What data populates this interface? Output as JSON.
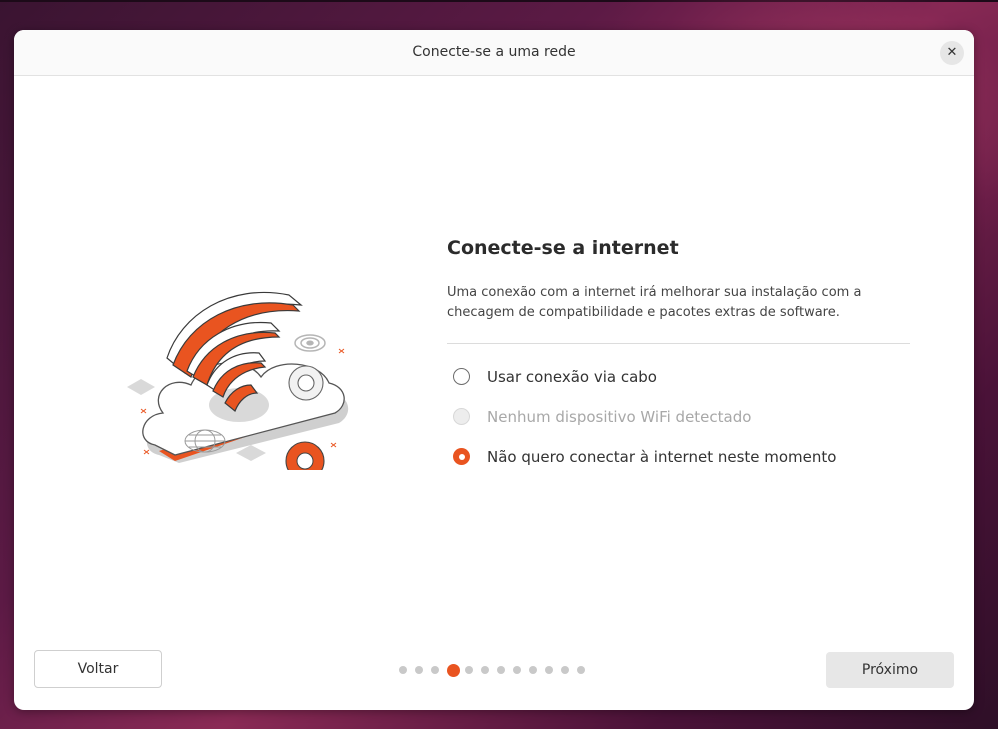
{
  "window": {
    "title": "Conecte-se a uma rede",
    "close_icon": "close-icon"
  },
  "main": {
    "heading": "Conecte-se a internet",
    "description_line1": "Uma conexão com a internet irá melhorar sua instalação com a",
    "description_line2": "checagem de compatibilidade e pacotes extras de software.",
    "options": [
      {
        "label": "Usar conexão via cabo",
        "state": "unselected"
      },
      {
        "label": "Nenhum dispositivo WiFi detectado",
        "state": "disabled"
      },
      {
        "label": "Não quero conectar à internet neste momento",
        "state": "selected"
      }
    ]
  },
  "footer": {
    "back_label": "Voltar",
    "next_label": "Próximo",
    "steps_total": 12,
    "steps_current": 4
  },
  "colors": {
    "accent": "#E95420",
    "window_bg": "#FFFFFF"
  }
}
